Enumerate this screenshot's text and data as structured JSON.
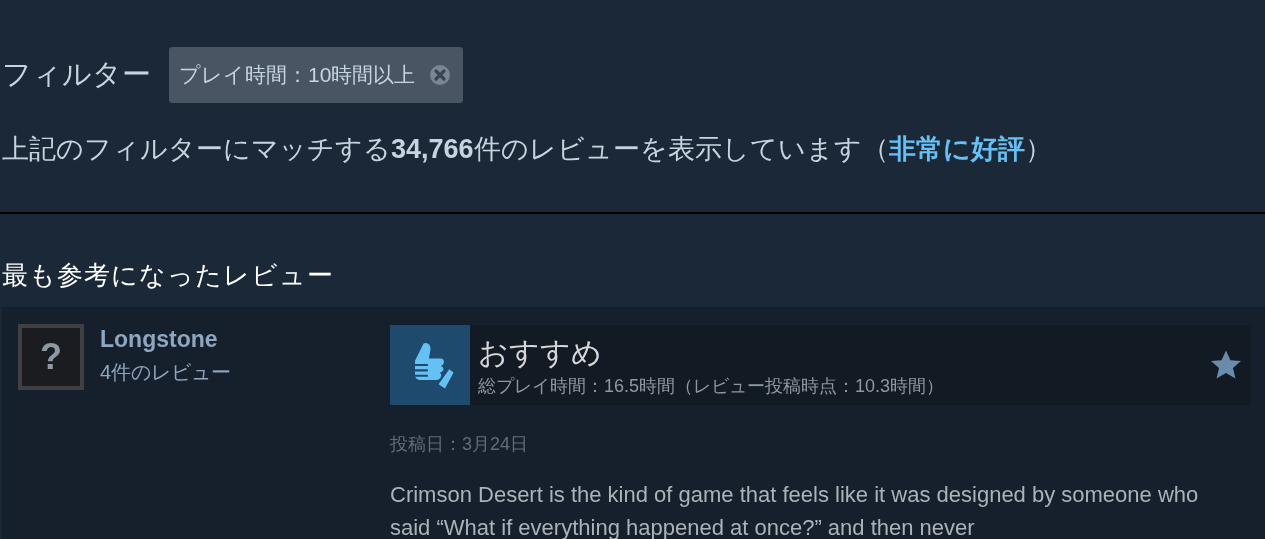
{
  "filter": {
    "label": "フィルター",
    "chip": "プレイ時間：10時間以上"
  },
  "summary": {
    "text": "上記のフィルターにマッチする**34,766**件のレビューを表示しています（",
    "rating": "非常に好評",
    "close": "）"
  },
  "section_title": "最も参考になったレビュー",
  "review": {
    "author": "Longstone",
    "review_count": "4件のレビュー",
    "avatar": "?",
    "verdict": "おすすめ",
    "recommended": true,
    "playtime": "総プレイ時間：16.5時間（レビュー投稿時点：10.3時間）",
    "posted": "投稿日：3月24日",
    "body": "Crimson Desert is the kind of game that feels like it was designed by someone who said “What if everything happened at once?” and then never"
  }
}
